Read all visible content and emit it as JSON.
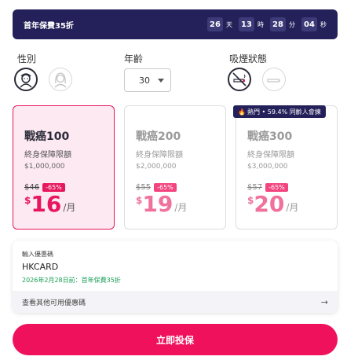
{
  "promo": {
    "label": "首年保費35折",
    "countdown": [
      {
        "value": "26",
        "unit": "天"
      },
      {
        "value": "13",
        "unit": "時"
      },
      {
        "value": "28",
        "unit": "分"
      },
      {
        "value": "04",
        "unit": "秒"
      }
    ]
  },
  "selectors": {
    "gender_label": "性別",
    "age_label": "年齡",
    "age_value": "30",
    "smoking_label": "吸煙狀態"
  },
  "plans": [
    {
      "name": "戰癌100",
      "subtitle": "終身保障限額",
      "amount": "$1,000,000",
      "old_price": "$46",
      "discount": "-65%",
      "currency": "$",
      "price": "16",
      "per": "/月"
    },
    {
      "name": "戰癌200",
      "subtitle": "終身保障限額",
      "amount": "$2,000,000",
      "old_price": "$55",
      "discount": "-65%",
      "currency": "$",
      "price": "19",
      "per": "/月"
    },
    {
      "name": "戰癌300",
      "subtitle": "終身保障限額",
      "amount": "$3,000,000",
      "old_price": "$57",
      "discount": "-65%",
      "currency": "$",
      "price": "20",
      "per": "/月"
    }
  ],
  "hot_badge": "熱門 • 59.4% 同齡人會揀",
  "coupon": {
    "label": "輸入優惠碼",
    "code": "HKCARD",
    "note": "2026年2月28日前：首年保費35折",
    "more": "查看其他可用優惠碼"
  },
  "cta_label": "立即投保",
  "colors": {
    "primary": "#f0115c",
    "navy": "#24215a",
    "success": "#18a058"
  }
}
